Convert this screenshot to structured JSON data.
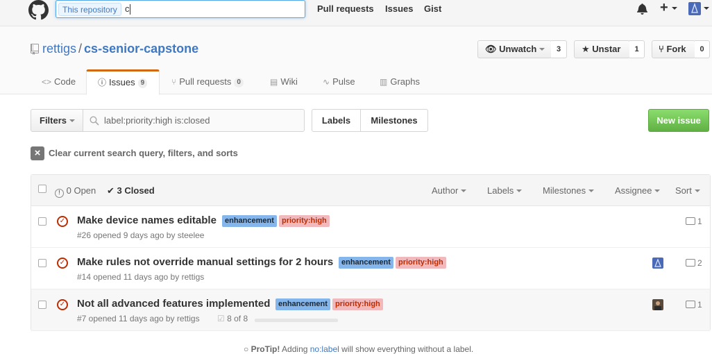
{
  "header": {
    "search_scope": "This repository",
    "search_value": "c",
    "nav": [
      "Pull requests",
      "Issues",
      "Gist"
    ],
    "icons": [
      "github-logo",
      "bell-icon",
      "plus-icon",
      "avatar"
    ]
  },
  "repo": {
    "owner": "rettigs",
    "name": "cs-senior-capstone",
    "watch": {
      "label": "Unwatch",
      "count": "3"
    },
    "star": {
      "label": "Unstar",
      "count": "1"
    },
    "fork": {
      "label": "Fork",
      "count": "0"
    }
  },
  "tabs": [
    {
      "label": "Code",
      "icon": "code-icon"
    },
    {
      "label": "Issues",
      "count": "9",
      "icon": "issue-icon"
    },
    {
      "label": "Pull requests",
      "count": "0",
      "icon": "pr-icon"
    },
    {
      "label": "Wiki",
      "icon": "book-icon"
    },
    {
      "label": "Pulse",
      "icon": "pulse-icon"
    },
    {
      "label": "Graphs",
      "icon": "graph-icon"
    }
  ],
  "filters": {
    "filters_label": "Filters",
    "query": "label:priority:high is:closed",
    "labels_label": "Labels",
    "milestones_label": "Milestones",
    "new_issue_label": "New issue",
    "clear_label": "Clear current search query, filters, and sorts"
  },
  "list_header": {
    "open_label": "0 Open",
    "closed_label": "3 Closed",
    "author": "Author",
    "labels": "Labels",
    "milestones": "Milestones",
    "assignee": "Assignee",
    "sort": "Sort"
  },
  "issues": [
    {
      "title": "Make device names editable",
      "labels": [
        "enhancement",
        "priority:high"
      ],
      "meta": "#26 opened 9 days ago by steelee",
      "comments": "1"
    },
    {
      "title": "Make rules not override manual settings for 2 hours",
      "labels": [
        "enhancement",
        "priority:high"
      ],
      "meta": "#14 opened 11 days ago by rettigs",
      "comments": "2"
    },
    {
      "title": "Not all advanced features implemented",
      "labels": [
        "enhancement",
        "priority:high"
      ],
      "meta": "#7 opened 11 days ago by rettigs",
      "tasks": "8 of 8",
      "comments": "1"
    }
  ],
  "protip": {
    "prefix": "ProTip!",
    "text": " Adding ",
    "link": "no:label",
    "suffix": " will show everything without a label."
  },
  "colors": {
    "accent": "#4078c0",
    "closed": "#bd2c00",
    "enhancement": "#84b6eb",
    "priority_high": "#f2b9bd",
    "new_issue": "#6cc644",
    "tab_active": "#d26911"
  }
}
